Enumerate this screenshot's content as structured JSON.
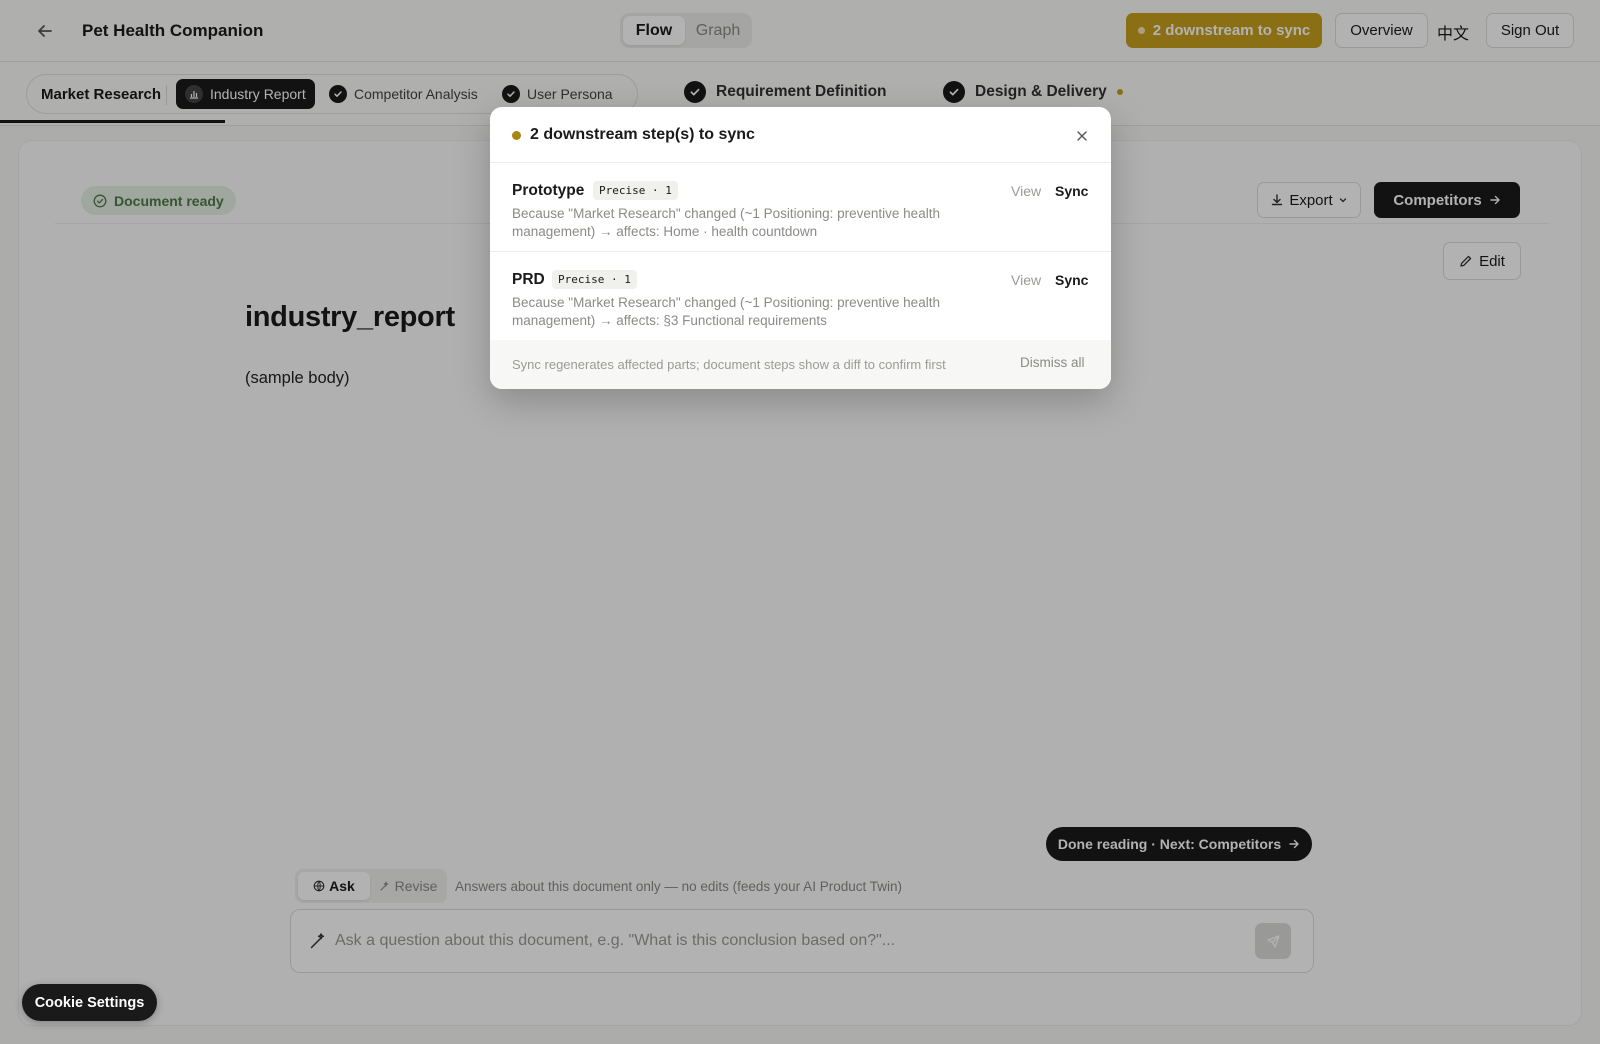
{
  "colors": {
    "accent_gold": "#c8a01e",
    "dark": "#1a1a1a",
    "success_green": "#4f7a4b"
  },
  "header": {
    "title": "Pet Health Companion",
    "view_tabs": [
      {
        "label": "Flow",
        "active": true
      },
      {
        "label": "Graph",
        "active": false
      }
    ],
    "sync_label": "2 downstream to sync",
    "overview_label": "Overview",
    "lang_label": "中文",
    "signout_label": "Sign Out"
  },
  "steps": {
    "current_phase": "Market Research",
    "substeps": [
      {
        "label": "Industry Report",
        "icon": "bar-chart-icon",
        "active": true
      },
      {
        "label": "Competitor Analysis",
        "icon": "check-icon",
        "active": false
      },
      {
        "label": "User Persona",
        "icon": "check-icon",
        "active": false
      }
    ],
    "phases": [
      {
        "label": "Requirement Definition",
        "icon": "check-icon"
      },
      {
        "label": "Design & Delivery",
        "icon": "check-icon"
      }
    ]
  },
  "document": {
    "status": "Document ready",
    "export_label": "Export",
    "next_label": "Competitors",
    "edit_label": "Edit",
    "title": "industry_report",
    "body": "(sample body)",
    "done_label": "Done reading · Next: Competitors"
  },
  "assistant": {
    "modes": [
      {
        "label": "Ask",
        "active": true
      },
      {
        "label": "Revise",
        "active": false
      }
    ],
    "hint": "Answers about this document only — no edits (feeds your AI Product Twin)",
    "placeholder": "Ask a question about this document, e.g. \"What is this conclusion based on?\"..."
  },
  "modal": {
    "title": "2 downstream step(s) to sync",
    "items": [
      {
        "name": "Prototype",
        "tag": "Precise · 1",
        "desc": "Because \"Market Research\" changed (~1 Positioning: preventive health management) → affects: Home · health countdown",
        "view_label": "View",
        "sync_label": "Sync"
      },
      {
        "name": "PRD",
        "tag": "Precise · 1",
        "desc": "Because \"Market Research\" changed (~1 Positioning: preventive health management) → affects: §3 Functional requirements",
        "view_label": "View",
        "sync_label": "Sync"
      }
    ],
    "footer_hint": "Sync regenerates affected parts; document steps show a diff to confirm first",
    "dismiss_label": "Dismiss all"
  },
  "cookie_label": "Cookie Settings"
}
